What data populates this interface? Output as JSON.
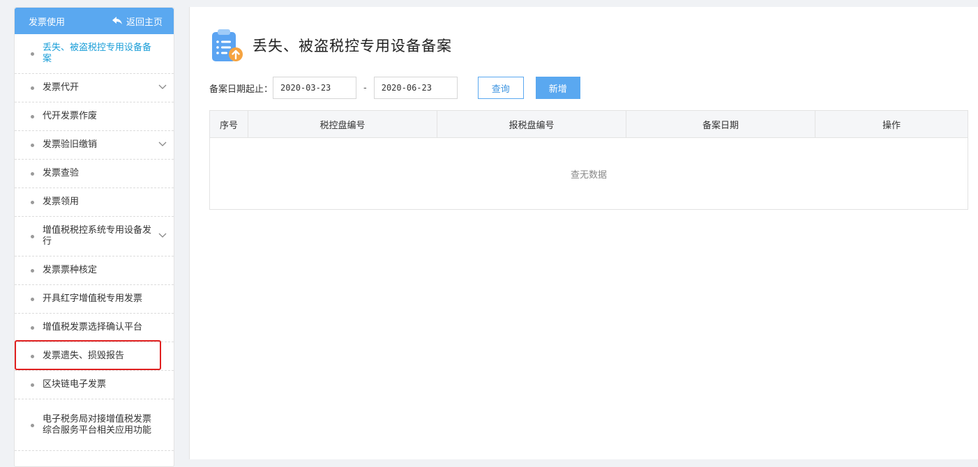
{
  "sidebar": {
    "title": "发票使用",
    "back_label": "返回主页",
    "items": [
      {
        "label": "丢失、被盗税控专用设备备案",
        "active": true,
        "expandable": false
      },
      {
        "label": "发票代开",
        "active": false,
        "expandable": true
      },
      {
        "label": "代开发票作废",
        "active": false,
        "expandable": false
      },
      {
        "label": "发票验旧缴销",
        "active": false,
        "expandable": true
      },
      {
        "label": "发票查验",
        "active": false,
        "expandable": false
      },
      {
        "label": "发票领用",
        "active": false,
        "expandable": false
      },
      {
        "label": "增值税税控系统专用设备发行",
        "active": false,
        "expandable": true
      },
      {
        "label": "发票票种核定",
        "active": false,
        "expandable": false
      },
      {
        "label": "开具红字增值税专用发票",
        "active": false,
        "expandable": false
      },
      {
        "label": "增值税发票选择确认平台",
        "active": false,
        "expandable": false
      },
      {
        "label": "发票遗失、损毁报告",
        "active": false,
        "expandable": false
      },
      {
        "label": "区块链电子发票",
        "active": false,
        "expandable": false
      },
      {
        "label": "电子税务局对接增值税发票综合服务平台相关应用功能",
        "active": false,
        "expandable": false
      }
    ]
  },
  "page": {
    "title": "丢失、被盗税控专用设备备案"
  },
  "filter": {
    "label": "备案日期起止：",
    "start_date": "2020-03-23",
    "separator": "-",
    "end_date": "2020-06-23",
    "query_label": "查询",
    "add_label": "新增"
  },
  "table": {
    "columns": [
      "序号",
      "税控盘编号",
      "报税盘编号",
      "备案日期",
      "操作"
    ],
    "empty_text": "查无数据"
  },
  "colors": {
    "accent": "#5aa8f0",
    "active_text": "#1a9ed8",
    "highlight_border": "#e02020"
  }
}
